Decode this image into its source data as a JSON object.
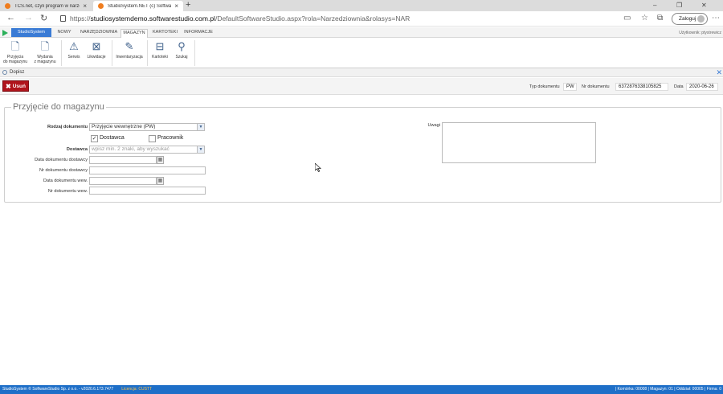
{
  "browser": {
    "tabs": [
      {
        "title": "TCS.net, czyli program w narzędz"
      },
      {
        "title": "StudioSystem.NET (c) SoftwareS"
      }
    ],
    "url_prefix": "https://",
    "url_host": "studiosystemdemo.softwarestudio.com.pl",
    "url_rest": "/DefaultSoftwareStudio.aspx?rola=Narzedziownia&rolasys=NAR",
    "login_label": "Zaloguj"
  },
  "menu": {
    "brand": "StudioSystem",
    "tabs": [
      "NOWY",
      "NARZĘDZIOWNIA",
      "MAGAZYN",
      "KARTOTEKI",
      "INFORMACJE"
    ],
    "right": "Użytkownik: ptystrewicz"
  },
  "ribbon": {
    "buttons": [
      {
        "label1": "Przyjęcia",
        "label2": "do magazynu"
      },
      {
        "label1": "Wydania",
        "label2": "z magazynu"
      },
      {
        "label1": "Serwis",
        "label2": ""
      },
      {
        "label1": "Likwidacje",
        "label2": ""
      },
      {
        "label1": "Inwentaryzacja",
        "label2": ""
      },
      {
        "label1": "Kartoteki",
        "label2": ""
      },
      {
        "label1": "Szukaj",
        "label2": ""
      }
    ]
  },
  "panel": {
    "title": "Dopisz"
  },
  "toolbar": {
    "delete_label": "Usuń",
    "doc_type_label": "Typ dokumentu",
    "doc_type_value": "PW",
    "doc_no_label": "Nr dokumentu",
    "doc_no_value": "637287633810582​5",
    "date_label": "Data",
    "date_value": "2020-06-26"
  },
  "form": {
    "legend": "Przyjęcie do magazynu",
    "rodzaj_label": "Rodzaj dokumentu",
    "rodzaj_value": "Przyjęcie wewnętrzne (PW)",
    "chk_dostawca": "Dostawca",
    "chk_pracownik": "Pracownik",
    "dostawca_label": "Dostawca",
    "dostawca_placeholder": "wpisz min. 2 znaki, aby wyszukać",
    "data_dost_label": "Data dokumentu dostawcy",
    "nr_dost_label": "Nr dokumentu dostawcy",
    "data_wew_label": "Data dokumentu wew.",
    "nr_wew_label": "Nr dokumentu wew.",
    "uwagi_label": "Uwagi"
  },
  "status": {
    "left": "StudioSystem © SoftwareStudio Sp. z o.o. - v2020.6.173.7477",
    "license": "Licencja: CUSTT",
    "right": "| Komórka: 00008 | Magazyn: 01 | Oddział: 00005 | Firma: 0"
  }
}
